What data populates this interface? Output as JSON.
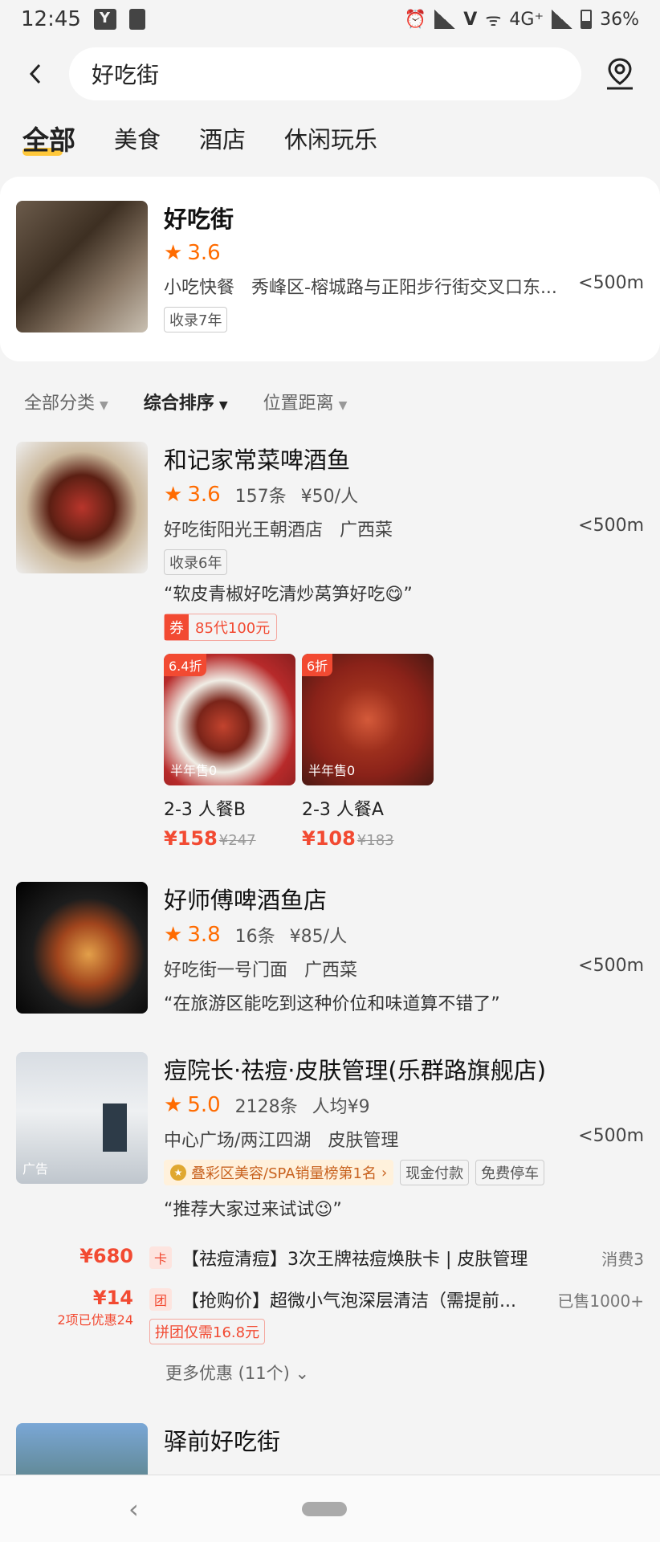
{
  "status": {
    "time": "12:45",
    "net": "4G⁺",
    "battery": "36%"
  },
  "search": {
    "query": "好吃街"
  },
  "tabs": [
    "全部",
    "美食",
    "酒店",
    "休闲玩乐"
  ],
  "top_result": {
    "name": "好吃街",
    "rating": "3.6",
    "category": "小吃快餐",
    "address": "秀峰区-榕城路与正阳步行街交叉口东...",
    "distance": "<500m",
    "tag": "收录7年"
  },
  "filters": [
    "全部分类",
    "综合排序",
    "位置距离"
  ],
  "items": [
    {
      "name": "和记家常菜啤酒鱼",
      "rating": "3.6",
      "reviews": "157条",
      "price": "¥50/人",
      "location": "好吃街阳光王朝酒店",
      "category": "广西菜",
      "distance": "<500m",
      "tag": "收录6年",
      "quote": "“软皮青椒好吃清炒莴笋好吃😋”",
      "coupon_badge": "券",
      "coupon_text": "85代100元",
      "deals": [
        {
          "discount": "6.4折",
          "sold": "半年售0",
          "name": "2-3 人餐B",
          "price": "¥158",
          "original": "¥247"
        },
        {
          "discount": "6折",
          "sold": "半年售0",
          "name": "2-3 人餐A",
          "price": "¥108",
          "original": "¥183"
        }
      ]
    },
    {
      "name": "好师傅啤酒鱼店",
      "rating": "3.8",
      "reviews": "16条",
      "price": "¥85/人",
      "location": "好吃街一号门面",
      "category": "广西菜",
      "distance": "<500m",
      "quote": "“在旅游区能吃到这种价位和味道算不错了”"
    },
    {
      "name": "痘院长·祛痘·皮肤管理(乐群路旗舰店)",
      "rating": "5.0",
      "reviews": "2128条",
      "price": "人均¥9",
      "location": "中心广场/两江四湖",
      "category": "皮肤管理",
      "distance": "<500m",
      "ad_label": "广告",
      "rank": "叠彩区美容/SPA销量榜第1名",
      "chips": [
        "现金付款",
        "免费停车"
      ],
      "quote": "“推荐大家过来试试😉”",
      "offers": [
        {
          "price": "¥680",
          "badge": "卡",
          "desc": "【祛痘清痘】3次王牌祛痘焕肤卡 | 皮肤管理",
          "right": "消费3"
        },
        {
          "price": "¥14",
          "sub": "2项已优惠24",
          "badge": "团",
          "desc": "【抢购价】超微小气泡深层清洁（需提前...",
          "right": "已售1000+",
          "pill": "拼团仅需16.8元"
        }
      ],
      "more": "更多优惠 (11个)"
    },
    {
      "name": "驿前好吃街"
    }
  ]
}
